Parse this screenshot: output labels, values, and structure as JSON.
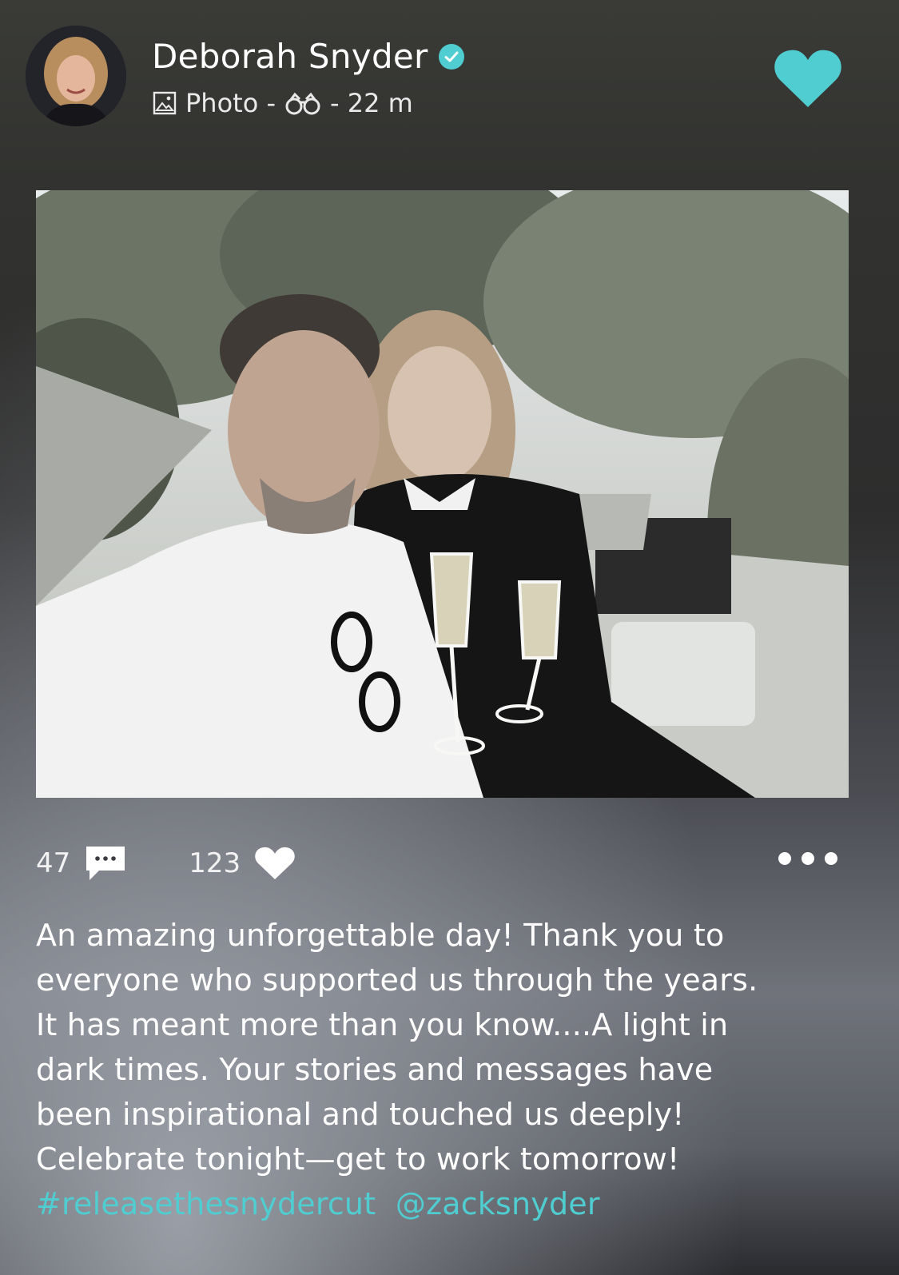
{
  "colors": {
    "accent": "#4fcdd0",
    "verified_badge": "#4fcdd0",
    "text": "#ffffff"
  },
  "author": {
    "name": "Deborah Snyder",
    "verified": true
  },
  "meta": {
    "type_icon": "image-icon",
    "type_label": "Photo -",
    "visibility_icon": "binoculars-icon",
    "time": "- 22 m"
  },
  "actions": {
    "like_icon": "heart-icon",
    "more_icon": "more-dots-icon"
  },
  "stats": {
    "comments": "47",
    "comment_icon": "comment-icon",
    "likes": "123",
    "like_icon": "heart-icon"
  },
  "caption": {
    "lines": [
      "An amazing unforgettable day!  Thank you to",
      "everyone who supported us through the years.",
      "It has meant more than you know....A light in",
      "dark times. Your stories and messages have",
      "been inspirational and touched us deeply!",
      "Celebrate tonight—get to work tomorrow!"
    ],
    "hashtag": "#releasethesnydercut",
    "mention": "@zacksnyder"
  }
}
